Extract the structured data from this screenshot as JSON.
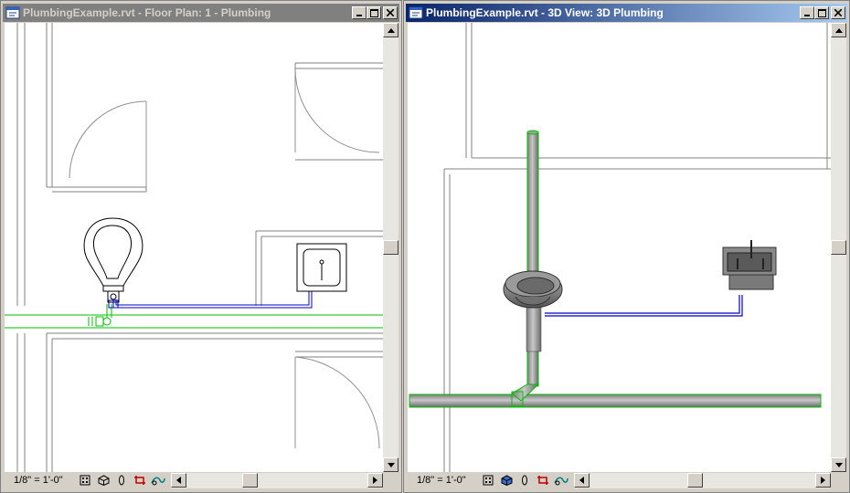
{
  "left_window": {
    "title": "PlumbingExample.rvt - Floor Plan: 1 - Plumbing",
    "scale": "1/8\" = 1'-0\"",
    "active": false,
    "vscroll_position": 0.5,
    "hscroll_position": 0.45
  },
  "right_window": {
    "title": "PlumbingExample.rvt - 3D View: 3D Plumbing",
    "scale": "1/8\" = 1'-0\"",
    "active": true,
    "vscroll_position": 0.5,
    "hscroll_position": 0.5
  },
  "titlebar_buttons": [
    "minimize-icon",
    "maximize-icon",
    "close-icon"
  ],
  "status_icons": [
    "detail-level-icon",
    "model-graphics-style-icon",
    "shadows-icon",
    "crop-region-icon",
    "hide-isolate-icon"
  ],
  "colors": {
    "pipe_green": "#00c000",
    "pipe_blue": "#0000c0",
    "pipe_gray": "#9a9a9a",
    "title_active": "#0a246a",
    "title_inactive": "#808080"
  }
}
